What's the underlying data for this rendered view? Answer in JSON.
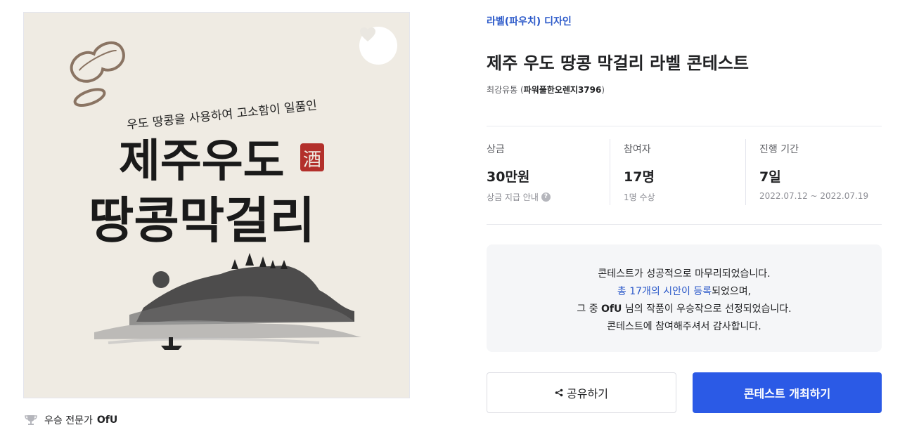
{
  "artwork": {
    "subtitle": "우도 땅콩을 사용하여 고소함이 일품인",
    "title_line1": "제주우도",
    "title_line2": "땅콩막걸리",
    "seal": "酒"
  },
  "winner": {
    "icon": "trophy-icon",
    "label": "우승 전문가",
    "name": "OfU"
  },
  "contest": {
    "category": "라벨(파우치) 디자인",
    "title": "제주 우도 땅콩 막걸리 라벨 콘테스트",
    "host_label": "최강유통",
    "host_name": "파워풀한오렌지3796"
  },
  "stats": {
    "prize": {
      "label": "상금",
      "value": "30만원",
      "sub": "상금 지급 안내",
      "icon": "question-icon"
    },
    "participants": {
      "label": "참여자",
      "value": "17명",
      "sub": "1명 수상"
    },
    "period": {
      "label": "진행 기간",
      "value": "7일",
      "sub": "2022.07.12 ~ 2022.07.19"
    }
  },
  "notice": {
    "line1": "콘테스트가 성공적으로 마무리되었습니다.",
    "line2_link": "총 17개의 시안이 등록",
    "line2_rest": "되었으며,",
    "line3_pre": "그 중 ",
    "line3_name": "OfU",
    "line3_post": " 님의 작품이 우승작으로 선정되었습니다.",
    "line4": "콘테스트에 참여해주셔서 감사합니다."
  },
  "buttons": {
    "share": "공유하기",
    "host": "콘테스트 개최하기"
  },
  "colors": {
    "accent": "#2b5ae6",
    "link": "#2a58c9",
    "artwork_bg": "#efebe3",
    "notice_bg": "#f5f6f8"
  }
}
